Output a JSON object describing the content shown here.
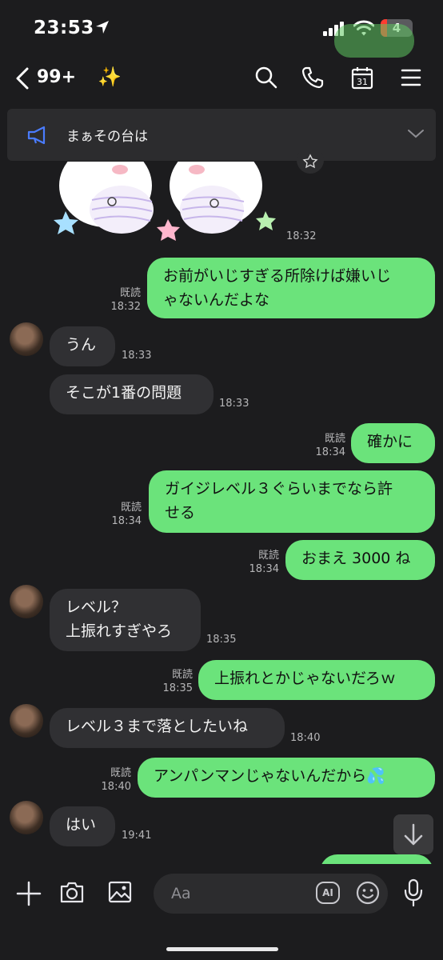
{
  "status_bar": {
    "time": "23:53",
    "battery": "4"
  },
  "header": {
    "unread_count": "99+",
    "sparkle": "✨"
  },
  "pinned": {
    "text": "まぁその台は"
  },
  "messages": [
    {
      "side": "right",
      "text": "お前がいじすぎる所除けば嫌いじ\nゃないんだよな",
      "read": "既読",
      "time": "18:32"
    },
    {
      "side": "left",
      "text": "うん",
      "time": "18:33"
    },
    {
      "side": "left",
      "text": "そこが1番の問題",
      "time": "18:33"
    },
    {
      "side": "right",
      "text": "確かに",
      "read": "既読",
      "time": "18:34"
    },
    {
      "side": "right",
      "text": "ガイジレベル３ぐらいまでなら許\nせる",
      "read": "既読",
      "time": "18:34"
    },
    {
      "side": "right",
      "text": "おまえ 3000 ね",
      "read": "既読",
      "time": "18:34"
    },
    {
      "side": "left",
      "text": "レベル？\n上振れすぎやろ",
      "time": "18:35"
    },
    {
      "side": "right",
      "text": "上振れとかじゃないだろｗ",
      "read": "既読",
      "time": "18:35"
    },
    {
      "side": "left",
      "text": "レベル３まで落としたいね",
      "time": "18:40"
    },
    {
      "side": "right",
      "text": "アンパンマンじゃないんだから💦",
      "read": "既読",
      "time": "18:40"
    },
    {
      "side": "left",
      "text": "はい",
      "time": "19:41"
    }
  ],
  "sticker": {
    "time": "18:32"
  },
  "input": {
    "placeholder": "Aa",
    "ai_label": "AI"
  },
  "colors": {
    "sent_bubble": "#6be37b",
    "received_bubble": "#303033",
    "background": "#1c1c1e"
  }
}
